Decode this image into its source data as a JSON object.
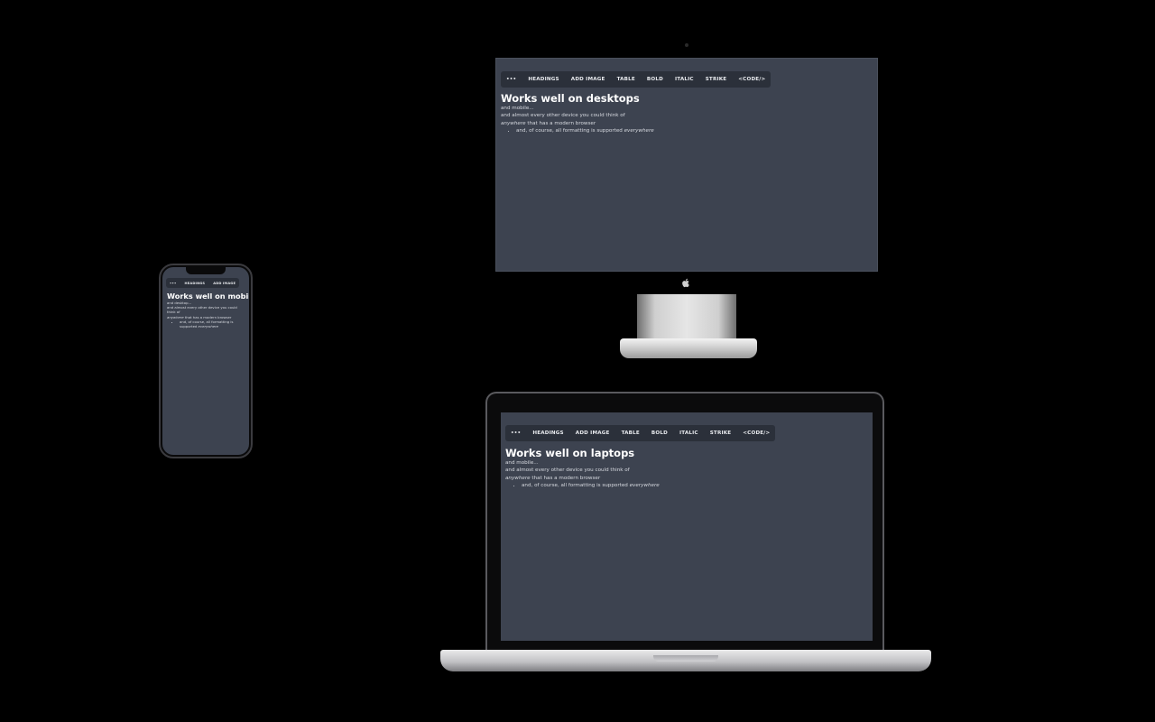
{
  "desktop": {
    "toolbar": [
      "•••",
      "HEADINGS",
      "ADD IMAGE",
      "TABLE",
      "BOLD",
      "ITALIC",
      "STRIKE",
      "<CODE/>"
    ],
    "title": "Works well on desktops",
    "line1": "and mobile...",
    "line2": "and almost every other device you could think of",
    "line3_em": "anywhere",
    "line3_rest": " that has a modern browser",
    "bullet_text": "and, of course, all formatting is supported ",
    "bullet_em": "everywhere"
  },
  "laptop": {
    "toolbar": [
      "•••",
      "HEADINGS",
      "ADD IMAGE",
      "TABLE",
      "BOLD",
      "ITALIC",
      "STRIKE",
      "<CODE/>"
    ],
    "title": "Works well on laptops",
    "line1": "and mobile...",
    "line2": "and almost every other device you could think of",
    "line3_em": "anywhere",
    "line3_rest": " that has a modern browser",
    "bullet_text": "and, of course, all formatting is supported ",
    "bullet_em": "everywhere"
  },
  "phone": {
    "toolbar": [
      "•••",
      "HEADINGS",
      "ADD IMAGE"
    ],
    "title": "Works well on mobile",
    "line1": "and desktop...",
    "line2": "and almost every other device you could think of",
    "line3_em": "anywhere",
    "line3_rest": " that has a modern browser",
    "bullet_text": "and, of course, all formatting is supported ",
    "bullet_em": "everywhere"
  },
  "icons": {
    "apple_logo": "apple-logo-icon"
  }
}
